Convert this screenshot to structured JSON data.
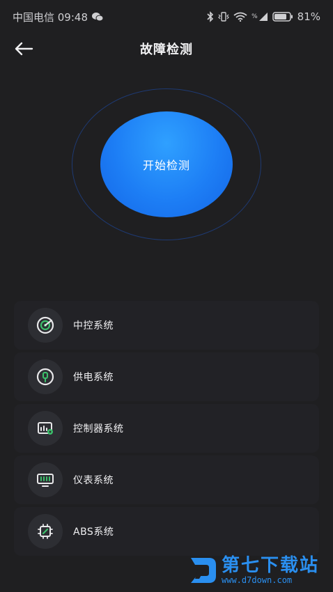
{
  "status_bar": {
    "carrier_time": "中国电信 09:48",
    "wechat_icon": "wechat-icon",
    "battery_percent": "81%",
    "signal_label": "%",
    "battery_level": 0.81
  },
  "header": {
    "title": "故障检测",
    "back_icon": "arrow-left-icon"
  },
  "detect": {
    "start_label": "开始检测"
  },
  "systems": [
    {
      "label": "中控系统",
      "icon": "radar-icon"
    },
    {
      "label": "供电系统",
      "icon": "plug-icon"
    },
    {
      "label": "控制器系统",
      "icon": "controller-icon"
    },
    {
      "label": "仪表系统",
      "icon": "dashboard-icon"
    },
    {
      "label": "ABS系统",
      "icon": "chip-icon"
    }
  ],
  "watermark": {
    "name": "第七下载站",
    "url": "www.d7down.com"
  },
  "colors": {
    "background": "#1f1f21",
    "accent_blue": "#1d7ef5",
    "icon_green": "#3cc06b",
    "watermark_blue": "#2a8ff0"
  }
}
